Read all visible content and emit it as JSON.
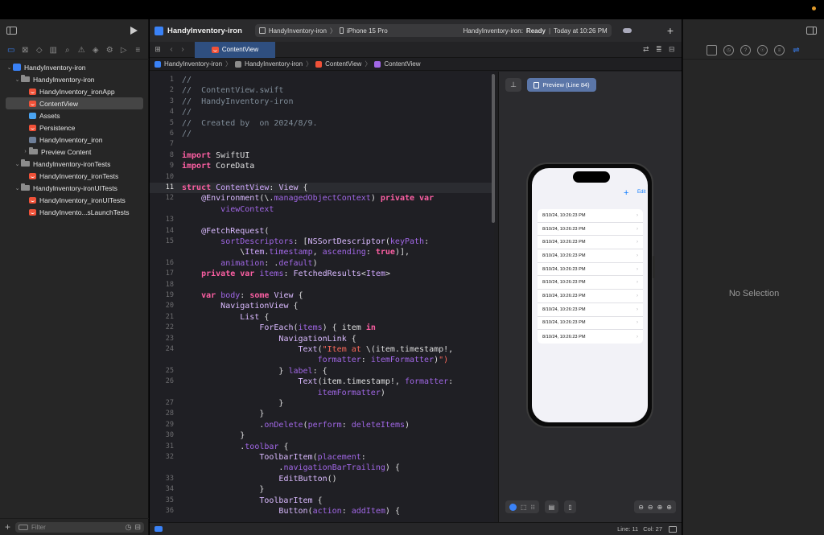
{
  "toolbar": {
    "project_name": "HandyInventory-iron",
    "scheme_name": "HandyInventory-iron",
    "scheme_sep": "〉",
    "device_name": "iPhone 15 Pro",
    "status_project": "HandyInventory-iron:",
    "status_state": "Ready",
    "status_sep": "|",
    "status_time": "Today at 10:26 PM"
  },
  "navigator": {
    "filter_placeholder": "Filter",
    "items": [
      {
        "label": "HandyInventory-iron",
        "indent": 0,
        "icon": "project-icon",
        "disclosure": "open"
      },
      {
        "label": "HandyInventory-iron",
        "indent": 1,
        "icon": "folder-icon",
        "disclosure": "open"
      },
      {
        "label": "HandyInventory_ironApp",
        "indent": 2,
        "icon": "swift-file-icon",
        "disclosure": "none"
      },
      {
        "label": "ContentView",
        "indent": 2,
        "icon": "swift-file-icon",
        "disclosure": "none",
        "selected": true
      },
      {
        "label": "Assets",
        "indent": 2,
        "icon": "asset-catalog-icon",
        "disclosure": "none"
      },
      {
        "label": "Persistence",
        "indent": 2,
        "icon": "swift-file-icon",
        "disclosure": "none"
      },
      {
        "label": "HandyInventory_iron",
        "indent": 2,
        "icon": "data-model-icon",
        "disclosure": "none"
      },
      {
        "label": "Preview Content",
        "indent": 2,
        "icon": "folder-icon",
        "disclosure": "closed"
      },
      {
        "label": "HandyInventory-ironTests",
        "indent": 1,
        "icon": "folder-icon",
        "disclosure": "open"
      },
      {
        "label": "HandyInventory_ironTests",
        "indent": 2,
        "icon": "swift-file-icon",
        "disclosure": "none"
      },
      {
        "label": "HandyInventory-ironUITests",
        "indent": 1,
        "icon": "folder-icon",
        "disclosure": "open"
      },
      {
        "label": "HandyInventory_ironUITests",
        "indent": 2,
        "icon": "swift-file-icon",
        "disclosure": "none"
      },
      {
        "label": "HandyInvento...sLaunchTests",
        "indent": 2,
        "icon": "swift-file-icon",
        "disclosure": "none"
      }
    ]
  },
  "editor": {
    "tab_label": "ContentView",
    "breadcrumbs": [
      "HandyInventory-iron",
      "HandyInventory-iron",
      "ContentView",
      "ContentView"
    ],
    "status_line": "Line: 11",
    "status_col": "Col: 27",
    "lines": [
      {
        "n": "1",
        "html": "<span class='cm'>//</span>"
      },
      {
        "n": "2",
        "html": "<span class='cm'>//  ContentView.swift</span>"
      },
      {
        "n": "3",
        "html": "<span class='cm'>//  HandyInventory-iron</span>"
      },
      {
        "n": "4",
        "html": "<span class='cm'>//</span>"
      },
      {
        "n": "5",
        "html": "<span class='cm'>//  Created by  on 2024/8/9.</span>"
      },
      {
        "n": "6",
        "html": "<span class='cm'>//</span>"
      },
      {
        "n": "7",
        "html": ""
      },
      {
        "n": "8",
        "html": "<span class='k'>import</span> SwiftUI"
      },
      {
        "n": "9",
        "html": "<span class='k'>import</span> CoreData"
      },
      {
        "n": "10",
        "html": ""
      },
      {
        "n": "11",
        "html": "<span class='k'>struct</span> <span class='ty'>ContentView</span>: <span class='ty2'>View</span> {",
        "current": true
      },
      {
        "n": "12",
        "html": "    <span class='ty2'>@Environment</span>(\\.<span class='pr'>managedObjectContext</span>) <span class='k'>private var</span>"
      },
      {
        "n": "",
        "html": "        <span class='pr'>viewContext</span>"
      },
      {
        "n": "13",
        "html": ""
      },
      {
        "n": "14",
        "html": "    <span class='ty2'>@FetchRequest</span>("
      },
      {
        "n": "15",
        "html": "        <span class='pr'>sortDescriptors</span>: [<span class='ty2'>NSSortDescriptor</span>(<span class='pr'>keyPath</span>:"
      },
      {
        "n": "",
        "html": "            \\<span class='ty'>Item</span>.<span class='pr'>timestamp</span>, <span class='pr'>ascending</span>: <span class='k'>true</span>)],"
      },
      {
        "n": "16",
        "html": "        <span class='pr'>animation</span>: .<span class='pr'>default</span>)"
      },
      {
        "n": "17",
        "html": "    <span class='k'>private var</span> <span class='pr'>items</span>: <span class='ty2'>FetchedResults</span>&lt;<span class='ty'>Item</span>&gt;"
      },
      {
        "n": "18",
        "html": ""
      },
      {
        "n": "19",
        "html": "    <span class='k'>var</span> <span class='pr'>body</span>: <span class='k'>some</span> <span class='ty2'>View</span> {"
      },
      {
        "n": "20",
        "html": "        <span class='ty2'>NavigationView</span> {"
      },
      {
        "n": "21",
        "html": "            <span class='ty2'>List</span> {"
      },
      {
        "n": "22",
        "html": "                <span class='ty2'>ForEach</span>(<span class='pr'>items</span>) { item <span class='k'>in</span>"
      },
      {
        "n": "23",
        "html": "                    <span class='ty2'>NavigationLink</span> {"
      },
      {
        "n": "24",
        "html": "                        <span class='ty2'>Text</span>(<span class='st'>\"Item at </span>\\(item.timestamp!,"
      },
      {
        "n": "",
        "html": "                            <span class='pr'>formatter</span>: <span class='pr'>itemFormatter</span>)<span class='st'>\")</span>"
      },
      {
        "n": "25",
        "html": "                    } <span class='pr'>label</span>: {"
      },
      {
        "n": "26",
        "html": "                        <span class='ty2'>Text</span>(item.timestamp!, <span class='pr'>formatter</span>:"
      },
      {
        "n": "",
        "html": "                            <span class='pr'>itemFormatter</span>)"
      },
      {
        "n": "27",
        "html": "                    }"
      },
      {
        "n": "28",
        "html": "                }"
      },
      {
        "n": "29",
        "html": "                .<span class='fn'>onDelete</span>(<span class='pr'>perform</span>: <span class='pr'>deleteItems</span>)"
      },
      {
        "n": "30",
        "html": "            }"
      },
      {
        "n": "31",
        "html": "            .<span class='fn'>toolbar</span> {"
      },
      {
        "n": "32",
        "html": "                <span class='ty2'>ToolbarItem</span>(<span class='pr'>placement</span>:"
      },
      {
        "n": "",
        "html": "                    .<span class='pr'>navigationBarTrailing</span>) {"
      },
      {
        "n": "33",
        "html": "                    <span class='ty2'>EditButton</span>()"
      },
      {
        "n": "34",
        "html": "                }"
      },
      {
        "n": "35",
        "html": "                <span class='ty2'>ToolbarItem</span> {"
      },
      {
        "n": "36",
        "html": "                    <span class='ty2'>Button</span>(<span class='pr'>action</span>: <span class='pr'>addItem</span>) {"
      }
    ]
  },
  "preview": {
    "button_label": "Preview (Line 84)",
    "nav_add": "+",
    "nav_edit": "Edit",
    "rows": [
      "8/10/24, 10:26:23 PM",
      "8/10/24, 10:26:23 PM",
      "8/10/24, 10:26:23 PM",
      "8/10/24, 10:26:23 PM",
      "8/10/24, 10:26:23 PM",
      "8/10/24, 10:26:23 PM",
      "8/10/24, 10:26:23 PM",
      "8/10/24, 10:26:23 PM",
      "8/10/24, 10:26:23 PM",
      "8/10/24, 10:26:23 PM"
    ],
    "chevron": "›"
  },
  "inspector": {
    "empty_label": "No Selection"
  },
  "colors": {
    "accent": "#3a82f7",
    "swift": "#f05138",
    "keyword": "#fc5fa3"
  }
}
